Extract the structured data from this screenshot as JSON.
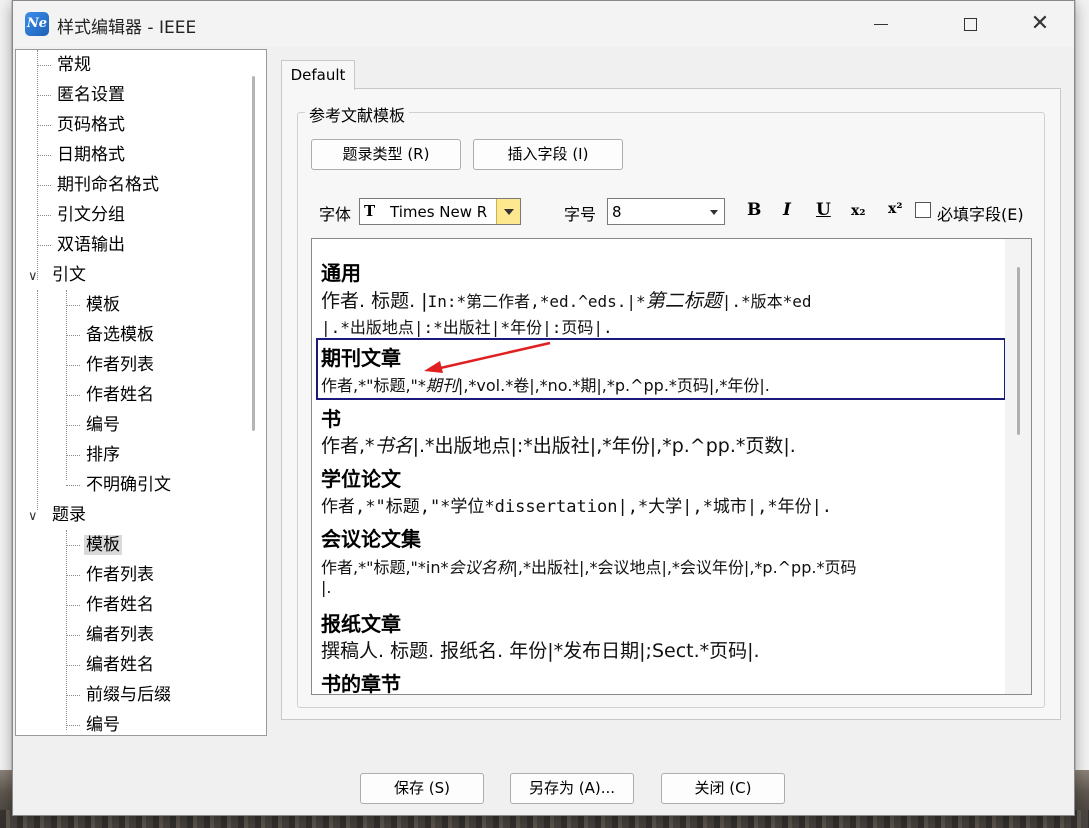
{
  "window": {
    "title": "样式编辑器 - IEEE",
    "app_icon_text": "Ne",
    "close_glyph": "✕"
  },
  "tree": {
    "items": [
      {
        "label": "常规"
      },
      {
        "label": "匿名设置"
      },
      {
        "label": "页码格式"
      },
      {
        "label": "日期格式"
      },
      {
        "label": "期刊命名格式"
      },
      {
        "label": "引文分组"
      },
      {
        "label": "双语输出"
      },
      {
        "label": "引文"
      },
      {
        "label": "模板"
      },
      {
        "label": "备选模板"
      },
      {
        "label": "作者列表"
      },
      {
        "label": "作者姓名"
      },
      {
        "label": "编号"
      },
      {
        "label": "排序"
      },
      {
        "label": "不明确引文"
      },
      {
        "label": "题录"
      },
      {
        "label": "模板"
      },
      {
        "label": "作者列表"
      },
      {
        "label": "作者姓名"
      },
      {
        "label": "编者列表"
      },
      {
        "label": "编者姓名"
      },
      {
        "label": "前缀与后缀"
      },
      {
        "label": "编号"
      }
    ],
    "selected_index": 16
  },
  "tab": {
    "label": "Default"
  },
  "group": {
    "title": "参考文献模板"
  },
  "toolbar": {
    "ref_type_button": "题录类型 (R)",
    "insert_field_button": "插入字段 (I)",
    "font_label": "字体",
    "font_value": "Times New R",
    "font_icon": "T",
    "size_label": "字号",
    "size_value": "8",
    "bold": "B",
    "italic": "I",
    "underline": "U",
    "subscript": "x₂",
    "superscript": "x²",
    "required_field_label": "必填字段(E)"
  },
  "templates": {
    "general": {
      "heading": "通用",
      "l1_a": "作者. 标题. |",
      "l1_b": "In:*第二作者,*ed.^eds.|*",
      "l1_c": "第二标题",
      "l1_d": "|.*版本*ed",
      "l2": "|.*出版地点|:*出版社|*年份|:页码|."
    },
    "journal": {
      "heading": "期刊文章",
      "a": "作者,*\"标题,\"*",
      "b": "期刊",
      "c": "|,*vol.*卷|,*no.*期|,*p.^pp.*页码|,*年份|."
    },
    "book": {
      "heading": "书",
      "a": "作者,*",
      "b": "书名",
      "c": "|.*出版地点|:*出版社|,*年份|,*p.^pp.*页数|."
    },
    "thesis": {
      "heading": "学位论文",
      "line": "作者,*\"标题,\"*学位*dissertation|,*大学|,*城市|,*年份|."
    },
    "conference": {
      "heading": "会议论文集",
      "a": "作者,*\"标题,\"*in*",
      "b": "会议名称",
      "c": "|,*出版社|,*会议地点|,*会议年份|,*p.^pp.*页码",
      "l2": "|."
    },
    "newspaper": {
      "heading": "报纸文章",
      "line": "撰稿人. 标题. 报纸名. 年份|*发布日期|;Sect.*页码|."
    },
    "book_section": {
      "heading": "书的章节"
    }
  },
  "footer": {
    "save": "保存 (S)",
    "save_as": "另存为 (A)...",
    "close": "关闭 (C)"
  },
  "colors": {
    "highlight_border": "#1a1a7a",
    "arrow": "#e02020",
    "font_dropdown": "#fde88f"
  }
}
